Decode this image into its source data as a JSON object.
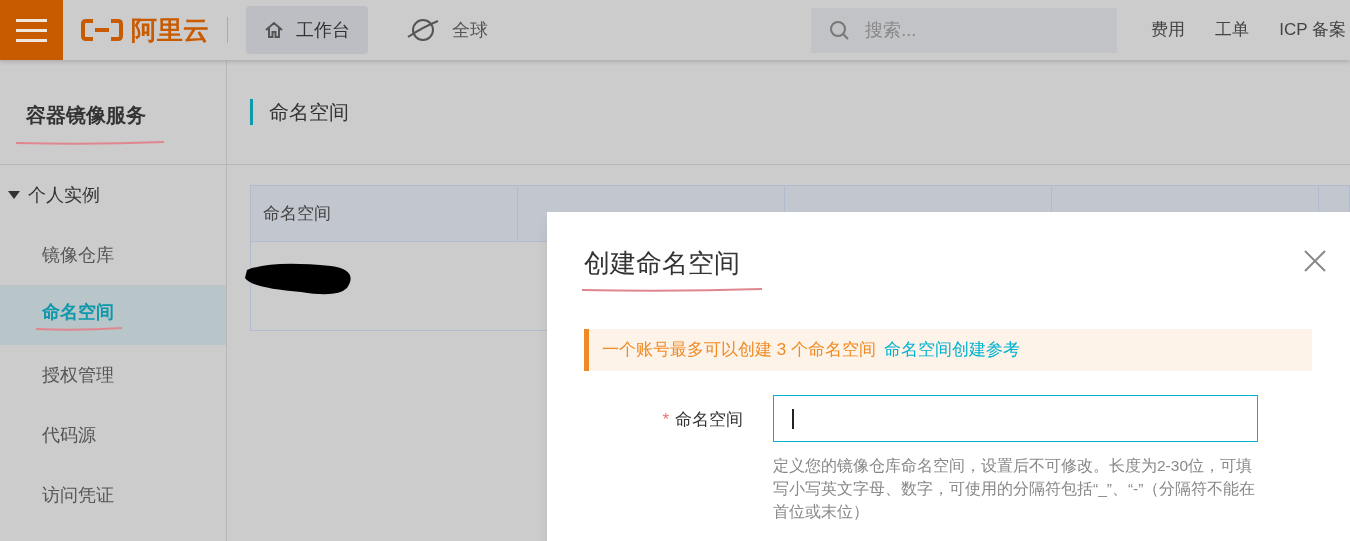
{
  "topbar": {
    "logo_text": "阿里云",
    "nav": [
      {
        "label": "工作台",
        "selected": true,
        "kind": "home"
      },
      {
        "label": "全球",
        "selected": false,
        "kind": "globe"
      }
    ],
    "search": {
      "placeholder": "搜索..."
    },
    "links": [
      "费用",
      "工单",
      "ICP 备案"
    ]
  },
  "sidebar": {
    "title": "容器镜像服务",
    "group": {
      "label": "个人实例",
      "expanded": true,
      "children": [
        {
          "label": "镜像仓库",
          "selected": false
        },
        {
          "label": "命名空间",
          "selected": true
        },
        {
          "label": "授权管理",
          "selected": false
        },
        {
          "label": "代码源",
          "selected": false
        },
        {
          "label": "访问凭证",
          "selected": false
        }
      ]
    }
  },
  "page": {
    "title": "命名空间",
    "table": {
      "columns": [
        "命名空间"
      ]
    }
  },
  "dialog": {
    "title": "创建命名空间",
    "alert": {
      "text": "一个账号最多可以创建 3 个命名空间",
      "link": "命名空间创建参考"
    },
    "field": {
      "label": "命名空间",
      "required_mark": "*",
      "help": "定义您的镜像仓库命名空间，设置后不可修改。长度为2-30位，可填写小写英文字母、数字，可使用的分隔符包括“_”、“-”（分隔符不能在首位或末位）"
    }
  }
}
